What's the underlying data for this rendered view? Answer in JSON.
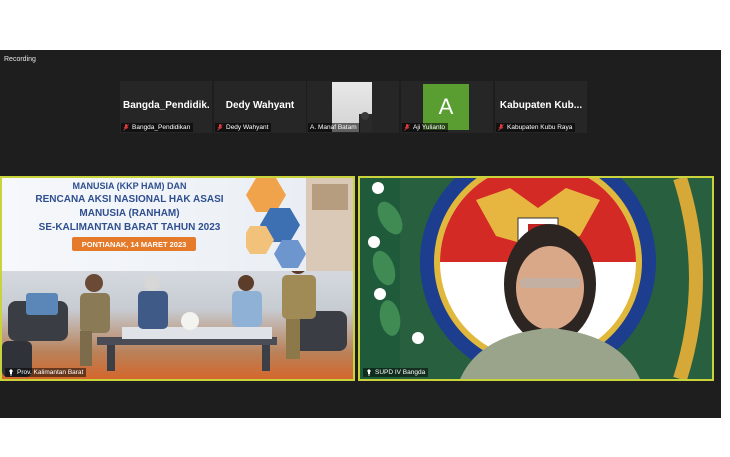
{
  "recording": "Recording",
  "participants_strip": [
    {
      "display": "Bangda_Pendidik...",
      "label": "Bangda_Pendidikan",
      "type": "name"
    },
    {
      "display": "Dedy Wahyant",
      "label": "Dedy Wahyant",
      "type": "name"
    },
    {
      "display": "",
      "label": "A. Manaf Batam",
      "type": "video"
    },
    {
      "display": "A",
      "label": "Aji Yulianto",
      "type": "avatar"
    },
    {
      "display": "Kabupaten  Kub...",
      "label": "Kabupaten Kubu Raya",
      "type": "name"
    }
  ],
  "main_left": {
    "label": "Prov. Kalimantan Barat",
    "banner": {
      "line1": "MANUSIA (KKP HAM) DAN",
      "line2": "RENCANA AKSI NASIONAL HAK ASASI",
      "line3": "MANUSIA (RANHAM)",
      "line4": "SE-KALIMANTAN BARAT TAHUN 2023",
      "date": "PONTIANAK, 14 MARET 2023"
    }
  },
  "main_right": {
    "label": "SUPD IV Bangda"
  },
  "colors": {
    "active_border": "#c9d43a",
    "banner_text": "#2f4f8f",
    "date_pill": "#e57b2a",
    "avatar": "#5a9e32"
  }
}
